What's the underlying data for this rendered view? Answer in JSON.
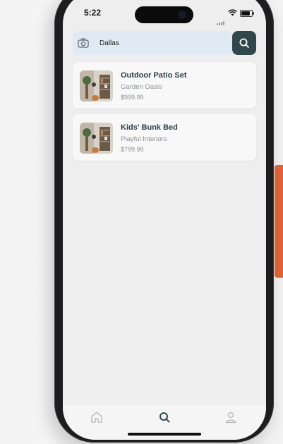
{
  "status_bar": {
    "time": "5:22",
    "battery_level": 0.85
  },
  "search": {
    "value": "Dallas",
    "placeholder": ""
  },
  "results": [
    {
      "title": "Outdoor Patio Set",
      "brand": "Garden Oasis",
      "price": "$999.99"
    },
    {
      "title": "Kids' Bunk Bed",
      "brand": "Playful Interiors",
      "price": "$799.99"
    }
  ],
  "tabs": [
    {
      "icon": "home-icon",
      "active": false
    },
    {
      "icon": "search-icon",
      "active": true
    },
    {
      "icon": "profile-icon",
      "active": false
    }
  ],
  "side_tab": {
    "label": ""
  },
  "colors": {
    "accent": "#30474c",
    "search_bg": "#dfeaf4",
    "side_tab": "#e2673a",
    "title_text": "#2d3e45",
    "muted_text": "#8a8f91"
  }
}
